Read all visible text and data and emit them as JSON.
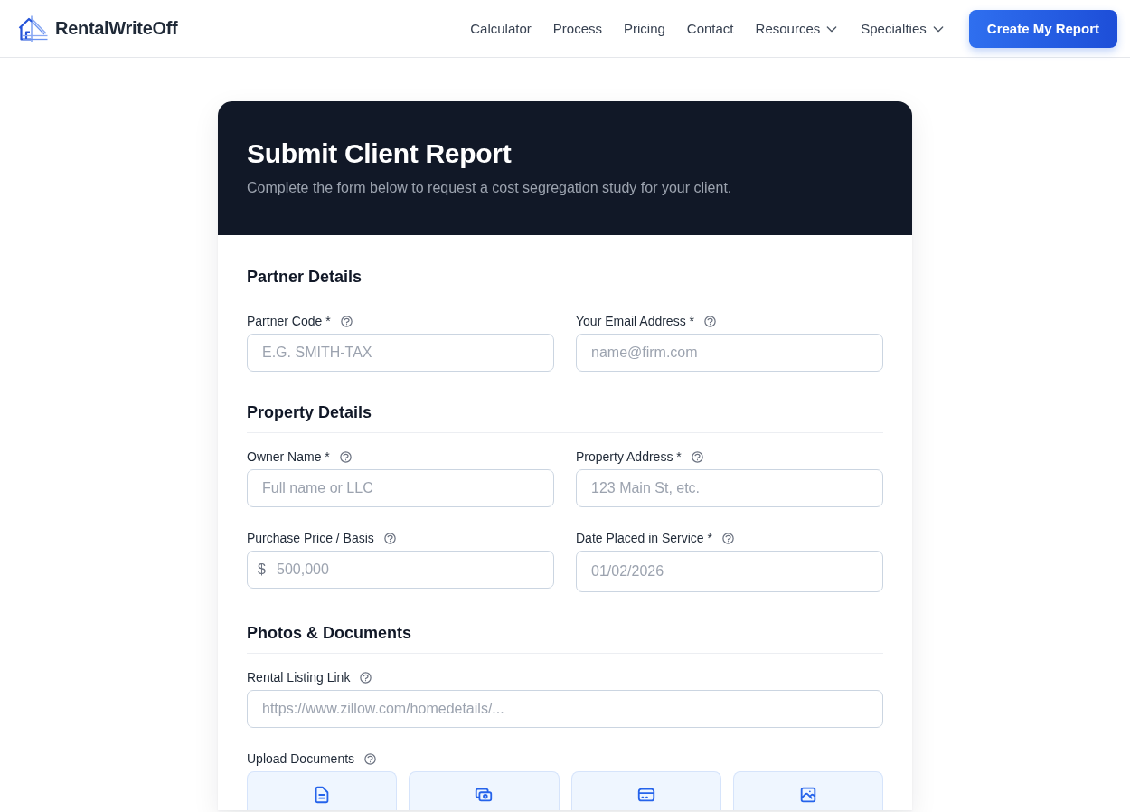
{
  "header": {
    "brand": "RentalWriteOff",
    "nav": [
      {
        "label": "Calculator",
        "kind": "link"
      },
      {
        "label": "Process",
        "kind": "link"
      },
      {
        "label": "Pricing",
        "kind": "link"
      },
      {
        "label": "Contact",
        "kind": "link"
      },
      {
        "label": "Resources",
        "kind": "menu"
      },
      {
        "label": "Specialties",
        "kind": "menu"
      }
    ],
    "cta": "Create My Report"
  },
  "form": {
    "title": "Submit Client Report",
    "subtitle": "Complete the form below to request a cost segregation study for your client.",
    "sections": [
      {
        "title": "Partner Details",
        "fields": [
          {
            "kind": "text",
            "label": "Partner Code *",
            "placeholder": "E.G. SMITH-TAX"
          },
          {
            "kind": "text",
            "label": "Your Email Address *",
            "placeholder": "name@firm.com"
          }
        ]
      },
      {
        "title": "Property Details",
        "fields": [
          {
            "kind": "text",
            "label": "Owner Name *",
            "placeholder": "Full name or LLC"
          },
          {
            "kind": "text",
            "label": "Property Address *",
            "placeholder": "123 Main St, etc."
          },
          {
            "kind": "currency",
            "label": "Purchase Price / Basis",
            "prefix": "$",
            "placeholder": "500,000"
          },
          {
            "kind": "date",
            "label": "Date Placed in Service *",
            "placeholder": "01/02/2026"
          }
        ]
      },
      {
        "title": "Photos & Documents",
        "fields": [
          {
            "kind": "url",
            "label": "Rental Listing Link",
            "placeholder": "https://www.zillow.com/homedetails/..."
          },
          {
            "kind": "upload",
            "label": "Upload Documents",
            "tiles": [
              {
                "kind": "document"
              },
              {
                "kind": "banknotes"
              },
              {
                "kind": "card"
              },
              {
                "kind": "image"
              }
            ]
          }
        ]
      }
    ]
  }
}
